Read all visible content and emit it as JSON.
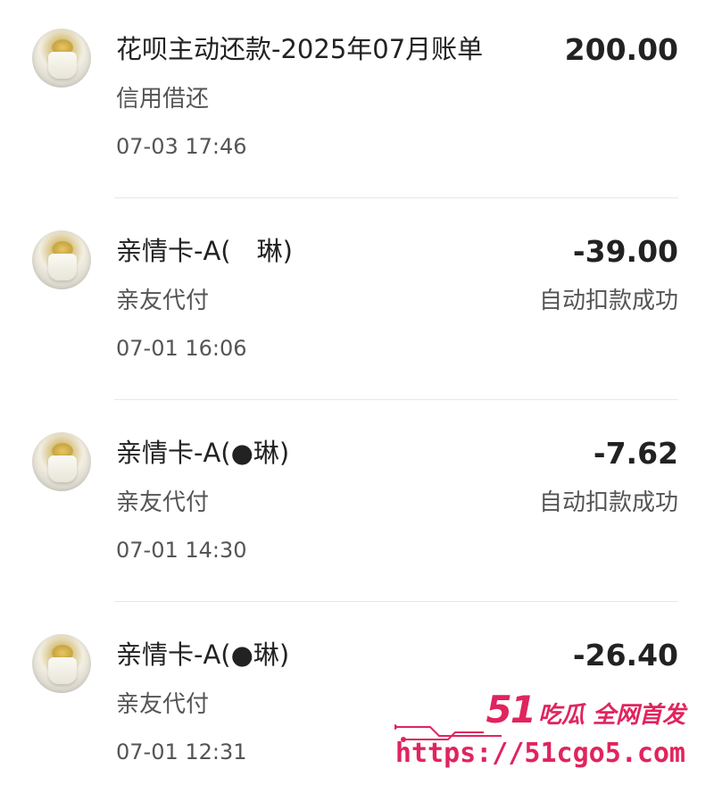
{
  "transactions": [
    {
      "title": "花呗主动还款-2025年07月账单",
      "subtitle": "信用借还",
      "time": "07-03 17:46",
      "amount": "200.00",
      "status": ""
    },
    {
      "title": "亲情卡-A(　琳)",
      "subtitle": "亲友代付",
      "time": "07-01 16:06",
      "amount": "-39.00",
      "status": "自动扣款成功"
    },
    {
      "title": "亲情卡-A(●琳)",
      "subtitle": "亲友代付",
      "time": "07-01 14:30",
      "amount": "-7.62",
      "status": "自动扣款成功"
    },
    {
      "title": "亲情卡-A(●琳)",
      "subtitle": "亲友代付",
      "time": "07-01 12:31",
      "amount": "-26.40",
      "status": ""
    }
  ],
  "watermark": {
    "number": "51",
    "text": "吃瓜 全网首发",
    "url": "https://51cgo5.com"
  },
  "colors": {
    "watermark": "#e0245e",
    "divider": "#e8e8e8"
  }
}
